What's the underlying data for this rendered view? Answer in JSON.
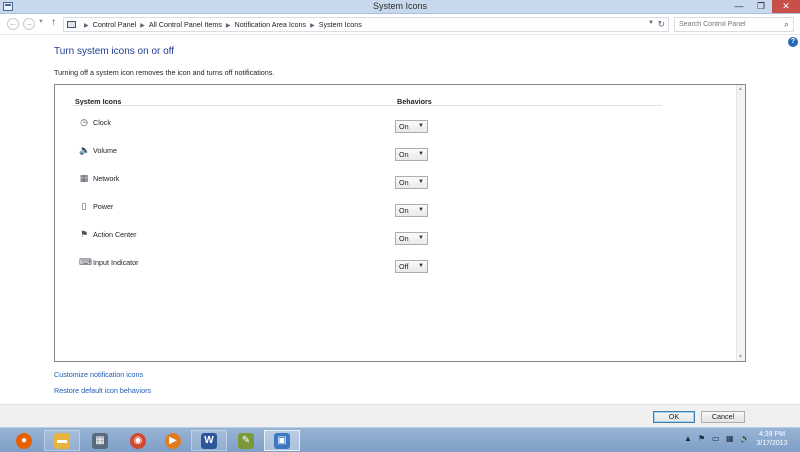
{
  "window": {
    "title": "System Icons",
    "minimize_glyph": "—",
    "maximize_glyph": "❐",
    "close_glyph": "✕"
  },
  "address": {
    "breadcrumbs": [
      "Control Panel",
      "All Control Panel Items",
      "Notification Area Icons",
      "System Icons"
    ],
    "search_placeholder": "Search Control Panel"
  },
  "help_glyph": "?",
  "main": {
    "title": "Turn system icons on or off",
    "description": "Turning off a system icon removes the icon and turns off notifications.",
    "columns": {
      "icons": "System Icons",
      "behaviors": "Behaviors"
    },
    "rows": [
      {
        "icon": "clock-icon",
        "glyph": "◷",
        "label": "Clock",
        "value": "On"
      },
      {
        "icon": "volume-icon",
        "glyph": "🔈",
        "label": "Volume",
        "value": "On"
      },
      {
        "icon": "network-icon",
        "glyph": "▦",
        "label": "Network",
        "value": "On"
      },
      {
        "icon": "power-icon",
        "glyph": "▯",
        "label": "Power",
        "value": "On"
      },
      {
        "icon": "action-center-icon",
        "glyph": "⚑",
        "label": "Action Center",
        "value": "On"
      },
      {
        "icon": "input-indicator-icon",
        "glyph": "⌨",
        "label": "Input Indicator",
        "value": "Off"
      }
    ]
  },
  "links": {
    "customize": "Customize notification icons",
    "restore": "Restore default icon behaviors"
  },
  "buttons": {
    "ok": "OK",
    "cancel": "Cancel"
  },
  "taskbar": {
    "items": [
      {
        "name": "firefox-icon",
        "glyph": "●",
        "color": "#e66000"
      },
      {
        "name": "file-explorer-icon",
        "glyph": "▬",
        "color": "#e8b341"
      },
      {
        "name": "control-panel-icon",
        "glyph": "▦",
        "color": "#5a6b80"
      },
      {
        "name": "chrome-icon",
        "glyph": "◉",
        "color": "#d04a2f"
      },
      {
        "name": "media-player-icon",
        "glyph": "▶",
        "color": "#e07b22"
      },
      {
        "name": "word-icon",
        "glyph": "W",
        "color": "#2b579a"
      },
      {
        "name": "paint-icon",
        "glyph": "✎",
        "color": "#7a9a3a"
      },
      {
        "name": "notification-settings-icon",
        "glyph": "▣",
        "color": "#3d78c2"
      }
    ],
    "clock": {
      "time": "4:39 PM",
      "date": "3/17/2013"
    }
  }
}
